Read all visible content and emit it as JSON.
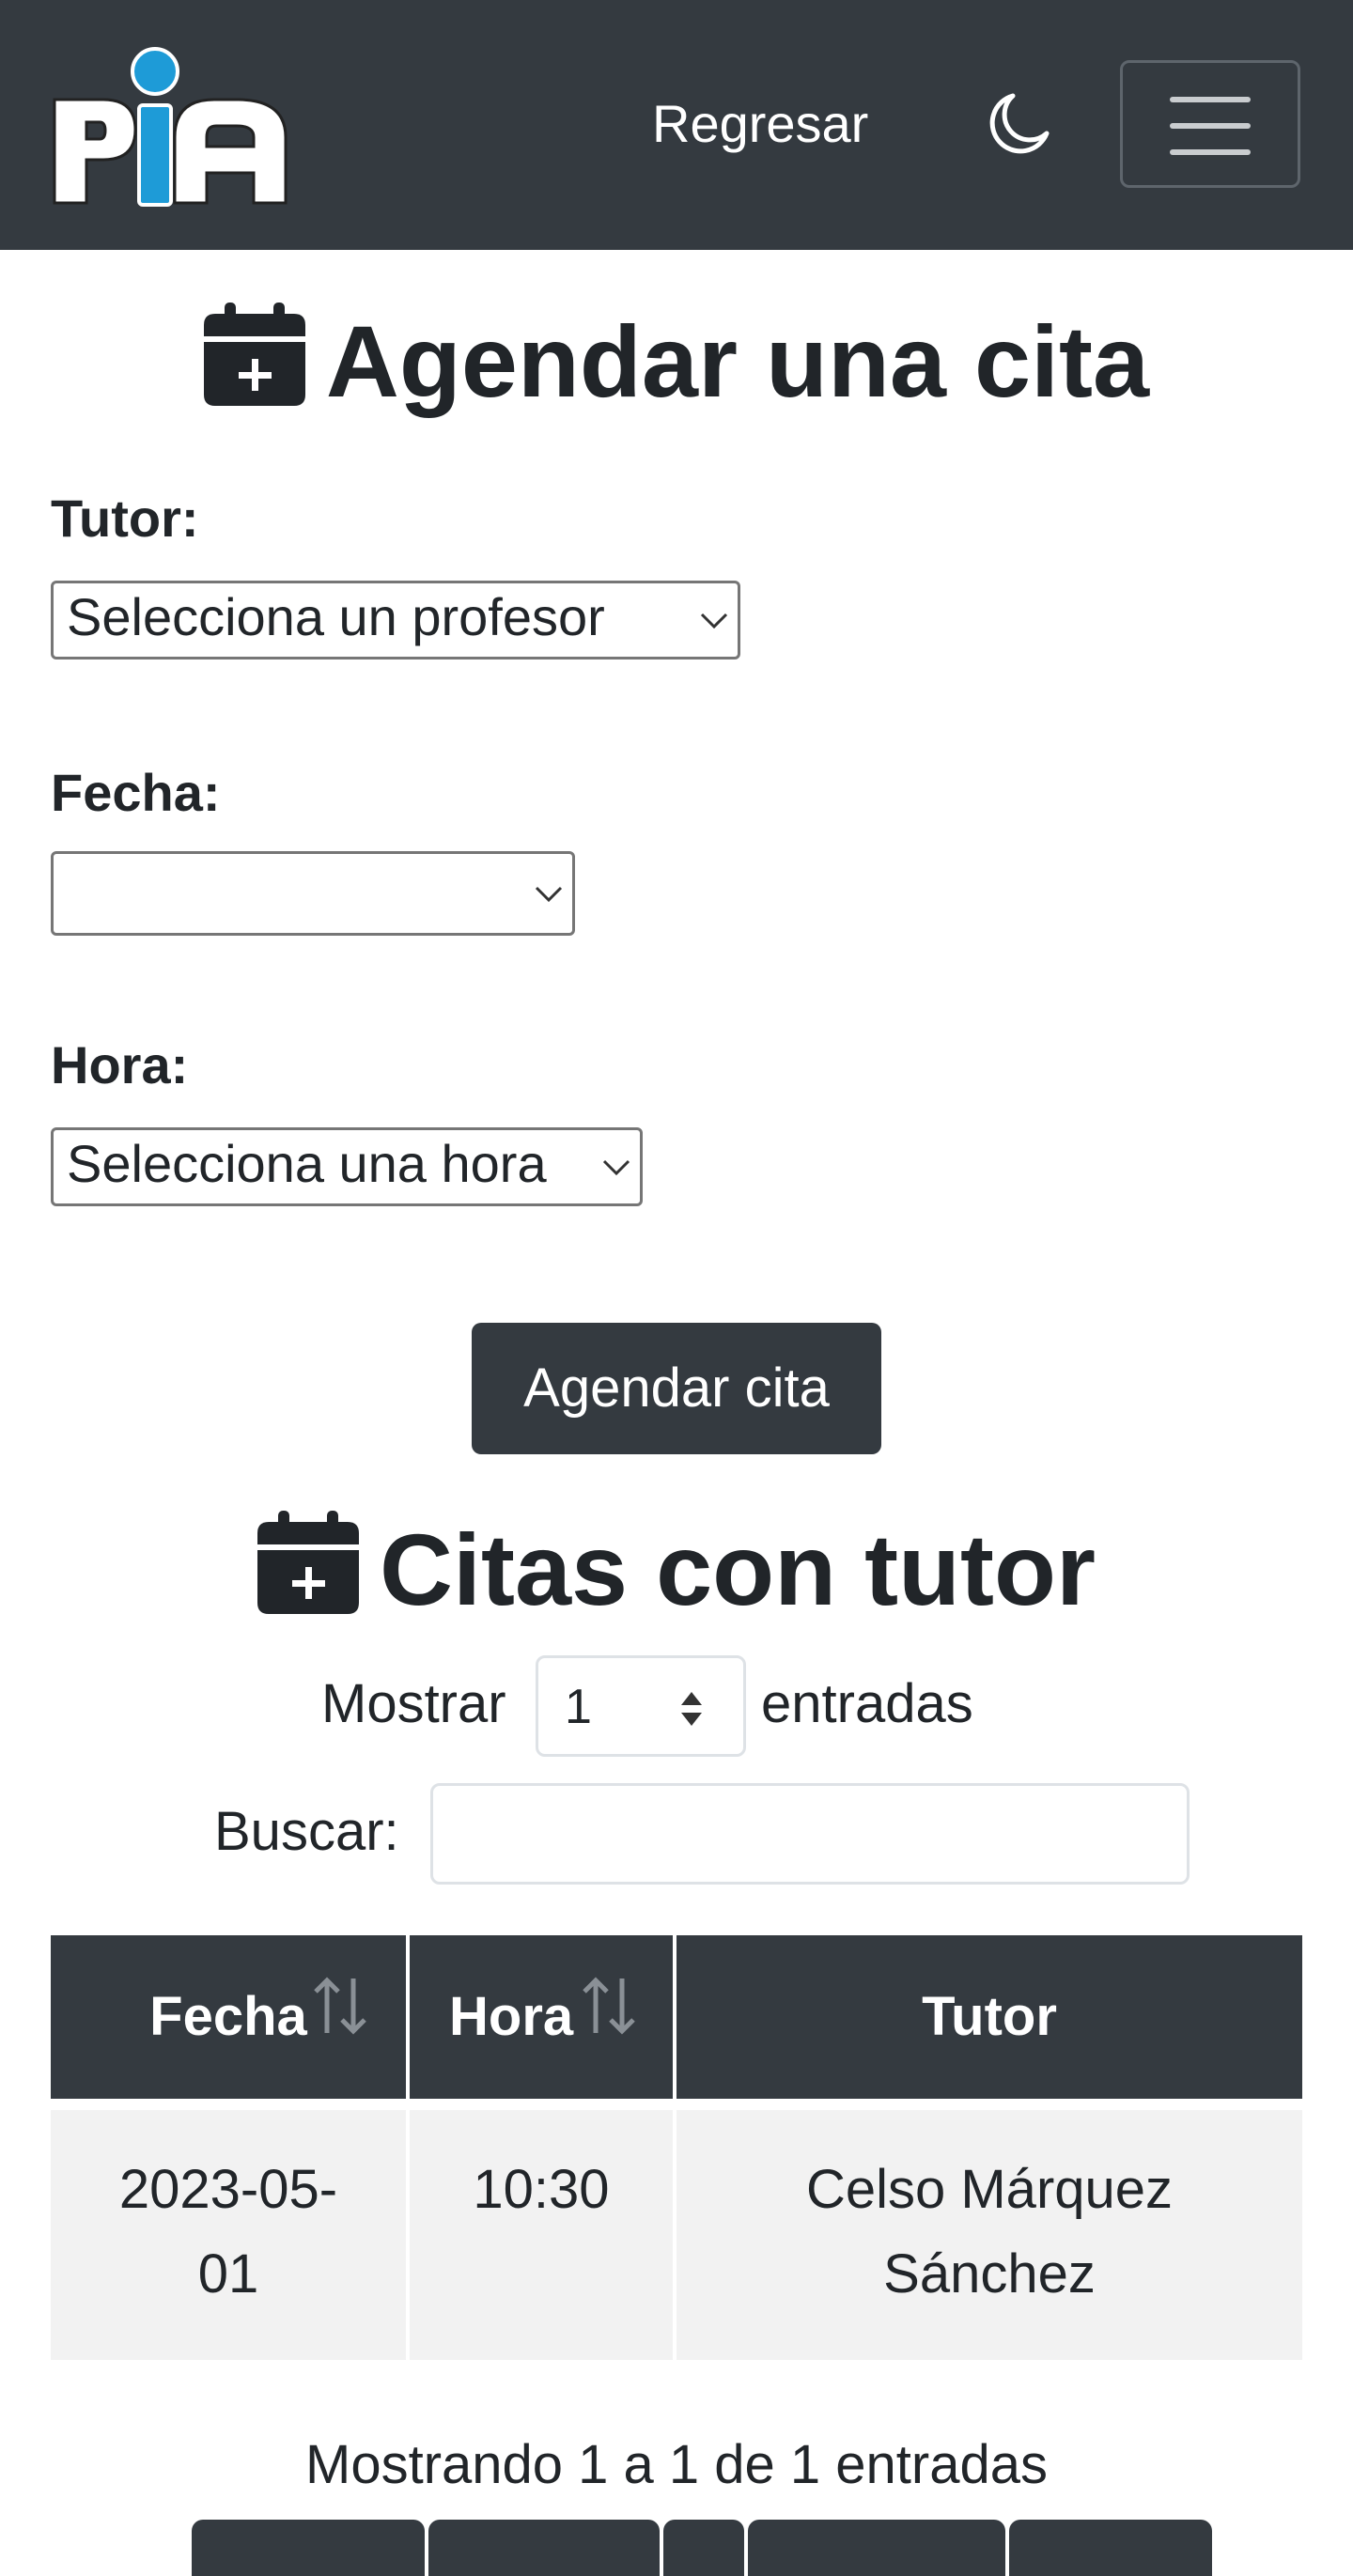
{
  "navbar": {
    "logo_text": "PIA",
    "back_label": "Regresar",
    "theme_icon": "moon-icon",
    "menu_icon": "hamburger-icon",
    "brand_colors": {
      "bar": "#343a40",
      "logo_dot": "#1e9bd7",
      "logo_letter_i": "#1e9bd7"
    }
  },
  "form": {
    "title": "Agendar una cita",
    "title_icon": "calendar-plus-icon",
    "tutor_label": "Tutor:",
    "tutor_value": "Selecciona un profesor",
    "date_label": "Fecha:",
    "date_value": "",
    "hour_label": "Hora:",
    "hour_value": "Selecciona una hora",
    "submit_label": "Agendar cita"
  },
  "appointments": {
    "title": "Citas con tutor",
    "title_icon": "calendar-plus-icon",
    "show_label": "Mostrar",
    "show_value": "1",
    "entries_label": "entradas",
    "search_label": "Buscar:",
    "search_value": "",
    "columns": [
      "Fecha",
      "Hora",
      "Tutor"
    ],
    "rows": [
      {
        "date_line1": "2023-05-",
        "date_line2": "01",
        "hour": "10:30",
        "tutor_line1": "Celso Márquez",
        "tutor_line2": "Sánchez"
      }
    ],
    "info": "Mostrando 1 a 1 de 1 entradas"
  }
}
